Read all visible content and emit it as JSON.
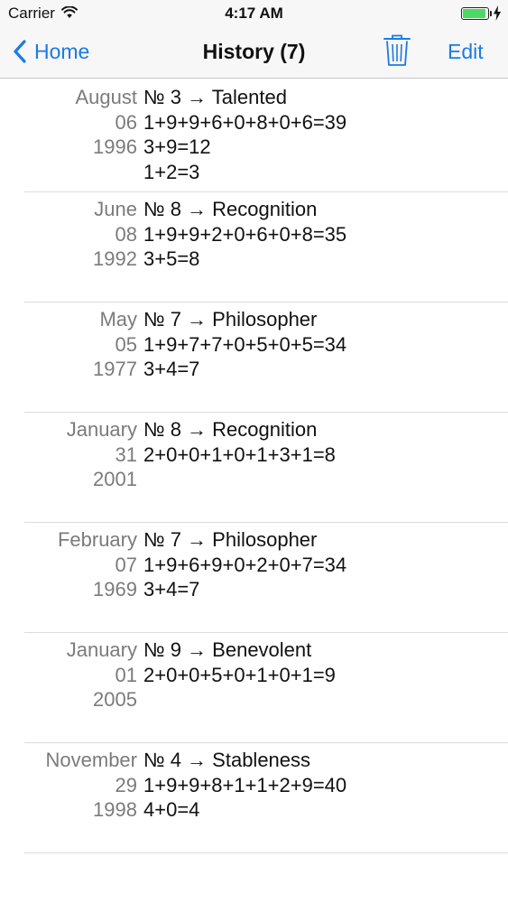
{
  "status_bar": {
    "carrier": "Carrier",
    "time": "4:17 AM",
    "battery_level": 0.95,
    "battery_color": "#4cd964"
  },
  "nav": {
    "back_label": "Home",
    "title": "History (7)",
    "edit_label": "Edit",
    "trash_icon": "trash-icon",
    "accent_color": "#1b7be5"
  },
  "entries": [
    {
      "month": "August",
      "day": "06",
      "year": "1996",
      "lines": [
        "№ 3 → Talented",
        "1+9+9+6+0+8+0+6=39",
        "3+9=12",
        "1+2=3"
      ]
    },
    {
      "month": "June",
      "day": "08",
      "year": "1992",
      "lines": [
        "№ 8 → Recognition",
        "1+9+9+2+0+6+0+8=35",
        "3+5=8"
      ]
    },
    {
      "month": "May",
      "day": "05",
      "year": "1977",
      "lines": [
        "№ 7 → Philosopher",
        "1+9+7+7+0+5+0+5=34",
        "3+4=7"
      ]
    },
    {
      "month": "January",
      "day": "31",
      "year": "2001",
      "lines": [
        "№ 8 → Recognition",
        "2+0+0+1+0+1+3+1=8"
      ]
    },
    {
      "month": "February",
      "day": "07",
      "year": "1969",
      "lines": [
        "№ 7 → Philosopher",
        "1+9+6+9+0+2+0+7=34",
        "3+4=7"
      ]
    },
    {
      "month": "January",
      "day": "01",
      "year": "2005",
      "lines": [
        "№ 9 → Benevolent",
        "2+0+0+5+0+1+0+1=9"
      ]
    },
    {
      "month": "November",
      "day": "29",
      "year": "1998",
      "lines": [
        "№ 4 → Stableness",
        "1+9+9+8+1+1+2+9=40",
        "4+0=4"
      ]
    }
  ]
}
